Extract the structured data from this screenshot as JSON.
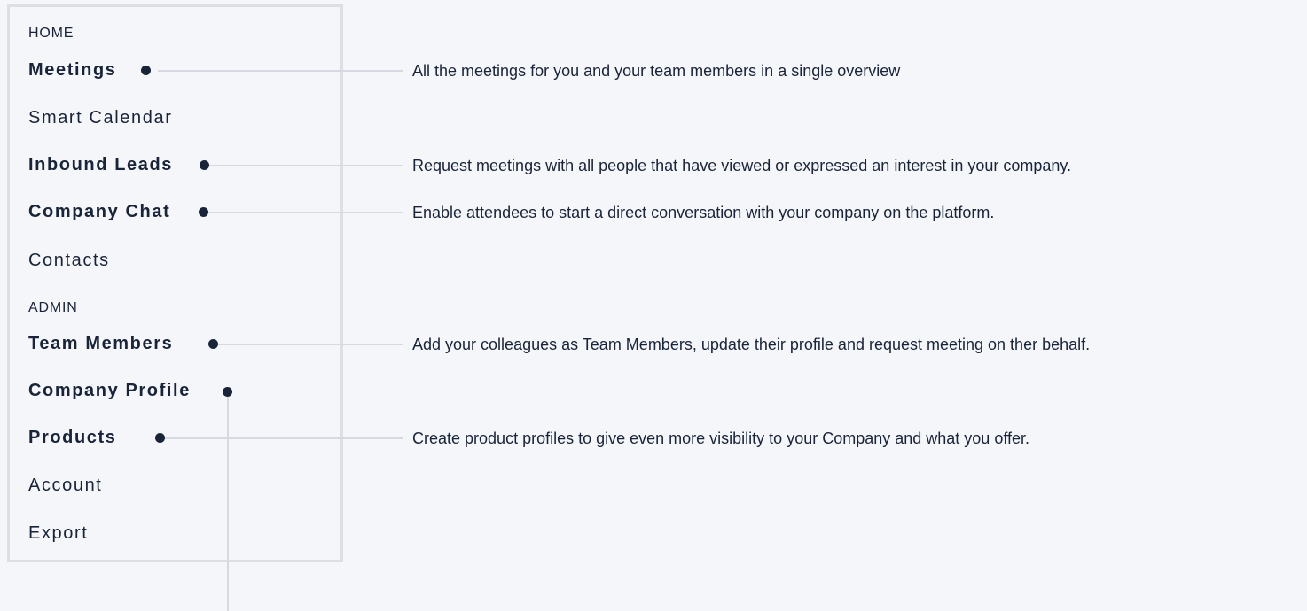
{
  "nav": {
    "home_label": "HOME",
    "admin_label": "ADMIN",
    "items": [
      {
        "label": "Meetings"
      },
      {
        "label": "Smart Calendar"
      },
      {
        "label": "Inbound Leads"
      },
      {
        "label": "Company Chat"
      },
      {
        "label": "Contacts"
      },
      {
        "label": "Team Members"
      },
      {
        "label": "Company Profile"
      },
      {
        "label": "Products"
      },
      {
        "label": "Account"
      },
      {
        "label": "Export"
      }
    ]
  },
  "annotations": {
    "meetings": "All the meetings for you and your team members in a single overview",
    "inbound_leads": "Request meetings with all people that have viewed or expressed an interest in your company.",
    "company_chat": "Enable attendees to start a direct conversation with your company on the platform.",
    "team_members": "Add your colleagues as Team Members, update their profile and request meeting on ther behalf.",
    "products": "Create product profiles to give even more visibility to your Company and what you offer."
  }
}
